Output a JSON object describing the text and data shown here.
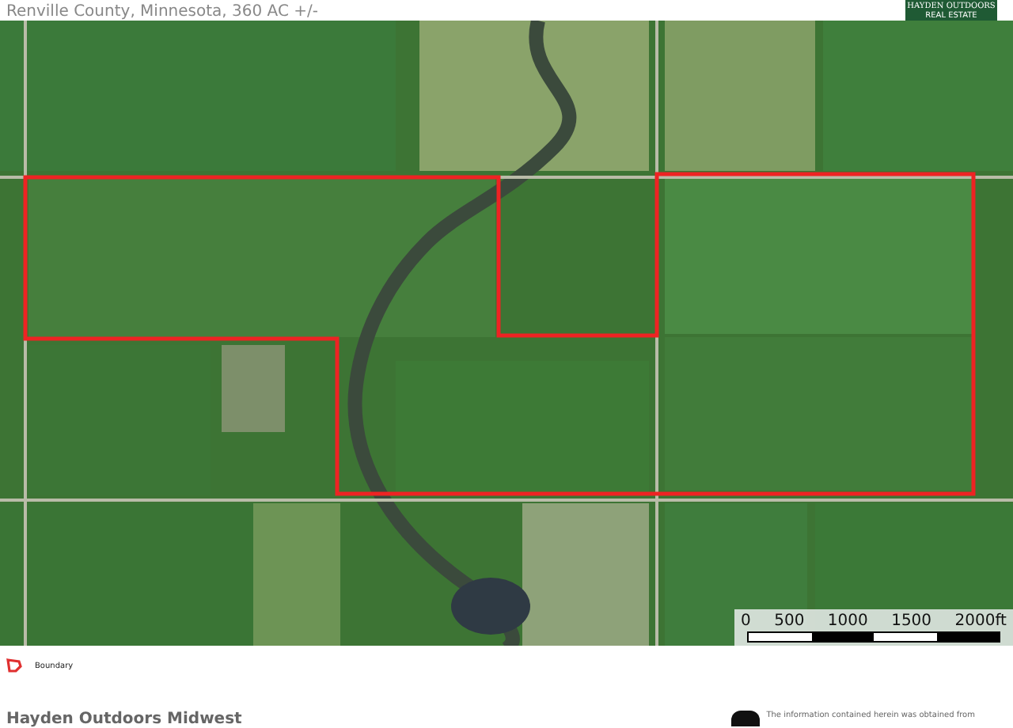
{
  "header": {
    "title": "Renville County, Minnesota, 360 AC +/-",
    "logo": [
      "HAYDEN OUTDOORS",
      "REAL ESTATE"
    ]
  },
  "map": {
    "scale_bar": {
      "labels": [
        "0",
        "500",
        "1000",
        "1500",
        "2000ft"
      ]
    }
  },
  "legend": [
    {
      "label": "Boundary"
    }
  ],
  "footer": {
    "company": "Hayden Outdoors Midwest",
    "disclaimer": "The information contained herein was obtained from"
  }
}
